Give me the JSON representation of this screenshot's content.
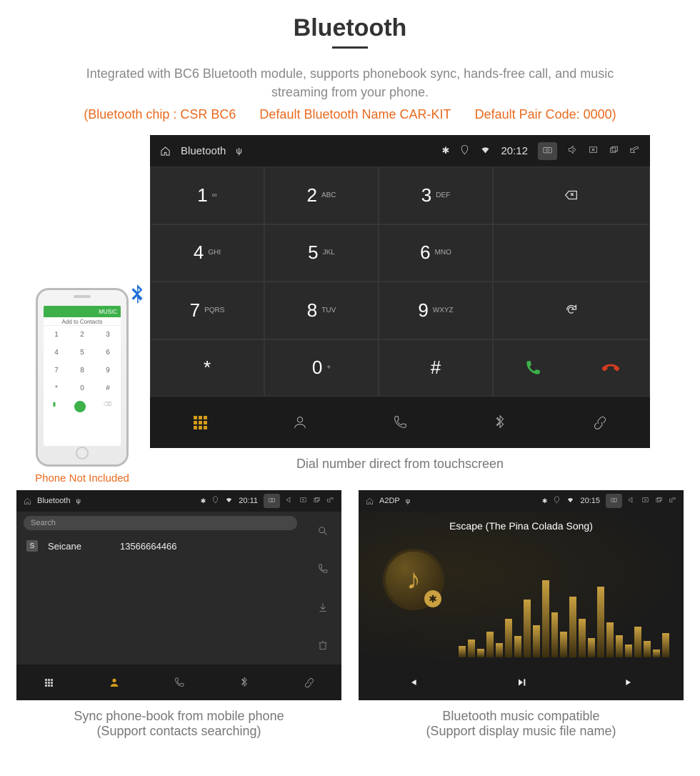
{
  "header": {
    "title": "Bluetooth",
    "description": "Integrated with BC6 Bluetooth module, supports phonebook sync, hands-free call, and music streaming from your phone.",
    "spec_chip": "(Bluetooth chip : CSR BC6",
    "spec_name": "Default Bluetooth Name CAR-KIT",
    "spec_pair": "Default Pair Code: 0000)"
  },
  "phone_mock": {
    "caption": "Phone Not Included",
    "bar_label": "MUSIC",
    "add_contacts": "Add to Contacts",
    "keys": [
      "1",
      "2",
      "3",
      "4",
      "5",
      "6",
      "7",
      "8",
      "9",
      "*",
      "0",
      "#"
    ]
  },
  "dialer": {
    "statusbar": {
      "title": "Bluetooth",
      "time": "20:12"
    },
    "keys": [
      {
        "n": "1",
        "s": "∞"
      },
      {
        "n": "2",
        "s": "ABC"
      },
      {
        "n": "3",
        "s": "DEF"
      },
      {
        "n": "4",
        "s": "GHI"
      },
      {
        "n": "5",
        "s": "JKL"
      },
      {
        "n": "6",
        "s": "MNO"
      },
      {
        "n": "7",
        "s": "PQRS"
      },
      {
        "n": "8",
        "s": "TUV"
      },
      {
        "n": "9",
        "s": "WXYZ"
      },
      {
        "n": "*",
        "s": ""
      },
      {
        "n": "0",
        "s": "+"
      },
      {
        "n": "#",
        "s": ""
      }
    ],
    "caption": "Dial number direct from touchscreen"
  },
  "phonebook": {
    "statusbar": {
      "title": "Bluetooth",
      "time": "20:11"
    },
    "search_placeholder": "Search",
    "contact_badge": "S",
    "contact_name": "Seicane",
    "contact_number": "13566664466",
    "caption_l1": "Sync phone-book from mobile phone",
    "caption_l2": "(Support contacts searching)"
  },
  "music": {
    "statusbar": {
      "title": "A2DP",
      "time": "20:15"
    },
    "song": "Escape (The Pina Colada Song)",
    "caption_l1": "Bluetooth music compatible",
    "caption_l2": "(Support display music file name)",
    "eq_bars": [
      18,
      28,
      14,
      40,
      22,
      60,
      34,
      90,
      50,
      120,
      70,
      40,
      95,
      60,
      30,
      110,
      55,
      35,
      20,
      48,
      26,
      12,
      38
    ]
  }
}
